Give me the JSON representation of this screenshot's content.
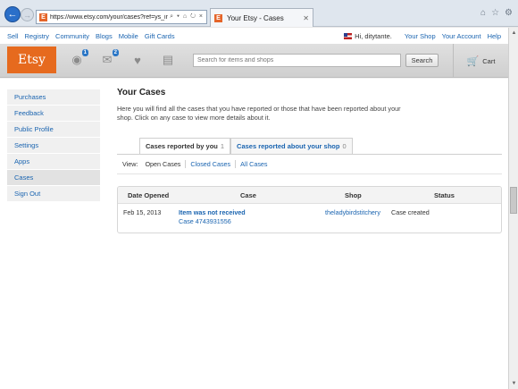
{
  "browser": {
    "url": "https://www.etsy.com/your/cases?ref=ys_in_c",
    "url_tools": "⌕ ▾ ⌂ ↻ ×",
    "tab_title": "Your Etsy - Cases",
    "tab_favicon": "E",
    "icons": [
      "home-icon",
      "star-icon",
      "gear-icon"
    ]
  },
  "toplinks": {
    "left": [
      "Sell",
      "Registry",
      "Community",
      "Blogs",
      "Mobile",
      "Gift Cards"
    ],
    "greeting": "Hi, ditytante.",
    "right": [
      "Your Shop",
      "Your Account",
      "Help"
    ]
  },
  "header": {
    "logo": "Etsy",
    "activity_badge": "1",
    "messages_badge": "2",
    "search_placeholder": "Search for items and shops",
    "search_button": "Search",
    "cart_label": "Cart"
  },
  "sidebar": {
    "items": [
      {
        "label": "Purchases"
      },
      {
        "label": "Feedback"
      },
      {
        "label": "Public Profile"
      },
      {
        "label": "Settings"
      },
      {
        "label": "Apps"
      },
      {
        "label": "Cases"
      },
      {
        "label": "Sign Out"
      }
    ]
  },
  "main": {
    "title": "Your Cases",
    "intro": "Here you will find all the cases that you have reported or those that have been reported about your shop. Click on any case to view more details about it.",
    "tabs": [
      {
        "label": "Cases reported by you",
        "count": "1"
      },
      {
        "label": "Cases reported about your shop",
        "count": "0"
      }
    ],
    "filter_label": "View:",
    "filters": [
      "Open Cases",
      "Closed Cases",
      "All Cases"
    ],
    "table": {
      "headers": [
        "Date Opened",
        "Case",
        "Shop",
        "Status"
      ],
      "rows": [
        {
          "date": "Feb 15, 2013",
          "case_title": "Item was not received",
          "case_number": "Case 4743931556",
          "shop": "theladybirdstitchery",
          "status": "Case created"
        }
      ]
    }
  }
}
